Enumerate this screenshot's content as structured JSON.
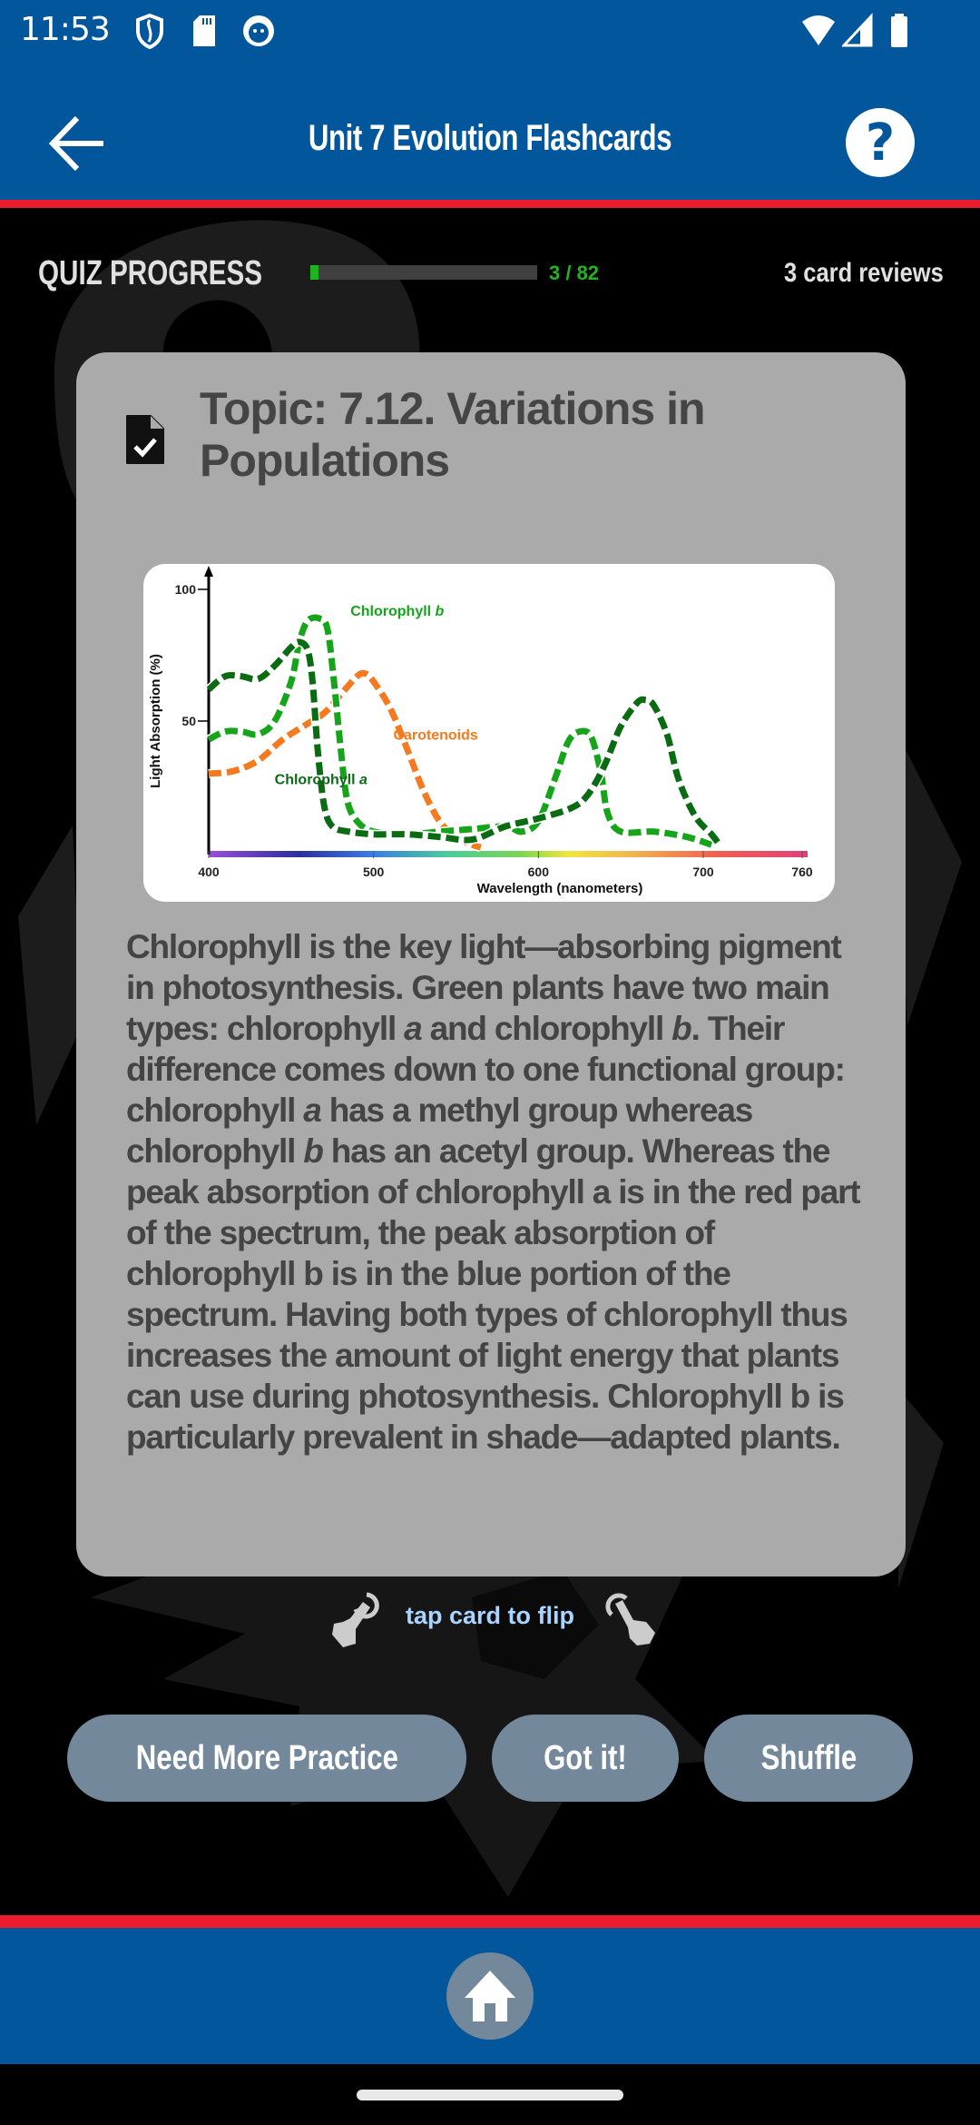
{
  "status_bar": {
    "time": "11:53",
    "left_icons": [
      "shield-icon",
      "sd-card-icon",
      "app-notification-icon"
    ],
    "right_icons": [
      "wifi-icon",
      "cell-signal-icon",
      "battery-icon"
    ]
  },
  "app_bar": {
    "title": "Unit 7 Evolution Flashcards",
    "back_icon": "arrow-left-icon",
    "help_label": "?"
  },
  "progress": {
    "label": "QUIZ PROGRESS",
    "current": 3,
    "total": 82,
    "count_text": "3 / 82",
    "reviews_text": "3 card reviews",
    "accent_color": "#1fb51f"
  },
  "card": {
    "icon": "file-check-icon",
    "topic": "Topic: 7.12. Variations in Populations",
    "body_segments": [
      {
        "t": "Chlorophyll is the key light—absorbing pigment in photosynthesis. Green plants have two main types: chlorophyll "
      },
      {
        "t": "a",
        "i": true
      },
      {
        "t": " and chlorophyll "
      },
      {
        "t": "b",
        "i": true
      },
      {
        "t": ".  Their difference comes down to one functional group: chlorophyll "
      },
      {
        "t": "a",
        "i": true
      },
      {
        "t": " has a methyl group whereas chlorophyll "
      },
      {
        "t": "b",
        "i": true
      },
      {
        "t": " has an acetyl group. Whereas the peak absorption of chlorophyll a is in the red part of the spectrum, the peak absorption of chlorophyll b is in the blue portion of the spectrum. Having both types of chlorophyll thus increases the amount of light energy that plants can use during photosynthesis. Chlorophyll b is particularly prevalent in shade—adapted plants."
      }
    ]
  },
  "chart_data": {
    "type": "line",
    "title": "",
    "xlabel": "Wavelength (nanometers)",
    "ylabel": "Light Absorption (%)",
    "xlim": [
      400,
      760
    ],
    "ylim": [
      0,
      100
    ],
    "x_ticks": [
      400,
      500,
      600,
      700,
      760
    ],
    "y_ticks": [
      50,
      100
    ],
    "grid": false,
    "legend": "inline-labels",
    "series": [
      {
        "name": "Chlorophyll a",
        "label_display": [
          "Chlorophyll ",
          "a"
        ],
        "color": "#0b6b12",
        "points": [
          [
            400,
            62
          ],
          [
            410,
            67
          ],
          [
            420,
            67
          ],
          [
            430,
            66
          ],
          [
            440,
            71
          ],
          [
            450,
            78
          ],
          [
            455,
            80
          ],
          [
            460,
            77
          ],
          [
            463,
            65
          ],
          [
            466,
            40
          ],
          [
            470,
            18
          ],
          [
            475,
            10
          ],
          [
            485,
            8
          ],
          [
            500,
            7
          ],
          [
            520,
            7
          ],
          [
            540,
            6
          ],
          [
            560,
            5
          ],
          [
            580,
            10
          ],
          [
            600,
            13
          ],
          [
            620,
            17
          ],
          [
            630,
            22
          ],
          [
            640,
            33
          ],
          [
            650,
            48
          ],
          [
            660,
            57
          ],
          [
            665,
            58
          ],
          [
            670,
            56
          ],
          [
            678,
            45
          ],
          [
            685,
            28
          ],
          [
            695,
            14
          ],
          [
            705,
            7
          ],
          [
            710,
            3
          ]
        ]
      },
      {
        "name": "Chlorophyll b",
        "label_display": [
          "Chlorophyll ",
          "b"
        ],
        "color": "#16a51a",
        "points": [
          [
            400,
            43
          ],
          [
            410,
            46
          ],
          [
            420,
            46
          ],
          [
            430,
            45
          ],
          [
            440,
            50
          ],
          [
            450,
            65
          ],
          [
            455,
            80
          ],
          [
            460,
            88
          ],
          [
            467,
            89
          ],
          [
            472,
            85
          ],
          [
            476,
            65
          ],
          [
            480,
            40
          ],
          [
            484,
            20
          ],
          [
            490,
            12
          ],
          [
            500,
            8
          ],
          [
            520,
            7
          ],
          [
            540,
            8
          ],
          [
            560,
            9
          ],
          [
            580,
            10
          ],
          [
            590,
            8
          ],
          [
            600,
            12
          ],
          [
            610,
            28
          ],
          [
            618,
            42
          ],
          [
            625,
            46
          ],
          [
            632,
            44
          ],
          [
            638,
            30
          ],
          [
            642,
            15
          ],
          [
            650,
            8
          ],
          [
            670,
            8
          ],
          [
            690,
            6
          ],
          [
            705,
            3
          ]
        ]
      },
      {
        "name": "Carotenoids",
        "label_display": [
          "Carotenoids"
        ],
        "color": "#f57a1f",
        "points": [
          [
            400,
            30
          ],
          [
            415,
            31
          ],
          [
            430,
            35
          ],
          [
            445,
            43
          ],
          [
            460,
            49
          ],
          [
            470,
            53
          ],
          [
            480,
            60
          ],
          [
            490,
            67
          ],
          [
            495,
            68
          ],
          [
            500,
            65
          ],
          [
            510,
            55
          ],
          [
            520,
            40
          ],
          [
            530,
            24
          ],
          [
            540,
            12
          ],
          [
            550,
            6
          ],
          [
            560,
            3
          ],
          [
            565,
            2
          ]
        ]
      }
    ]
  },
  "flip_hint": {
    "text": "tap card to flip",
    "left_icon": "tap-hand-left-icon",
    "right_icon": "tap-hand-right-icon"
  },
  "actions": {
    "need_practice": "Need More Practice",
    "got_it": "Got it!",
    "shuffle": "Shuffle"
  },
  "bottom_bar": {
    "home_icon": "home-icon"
  }
}
